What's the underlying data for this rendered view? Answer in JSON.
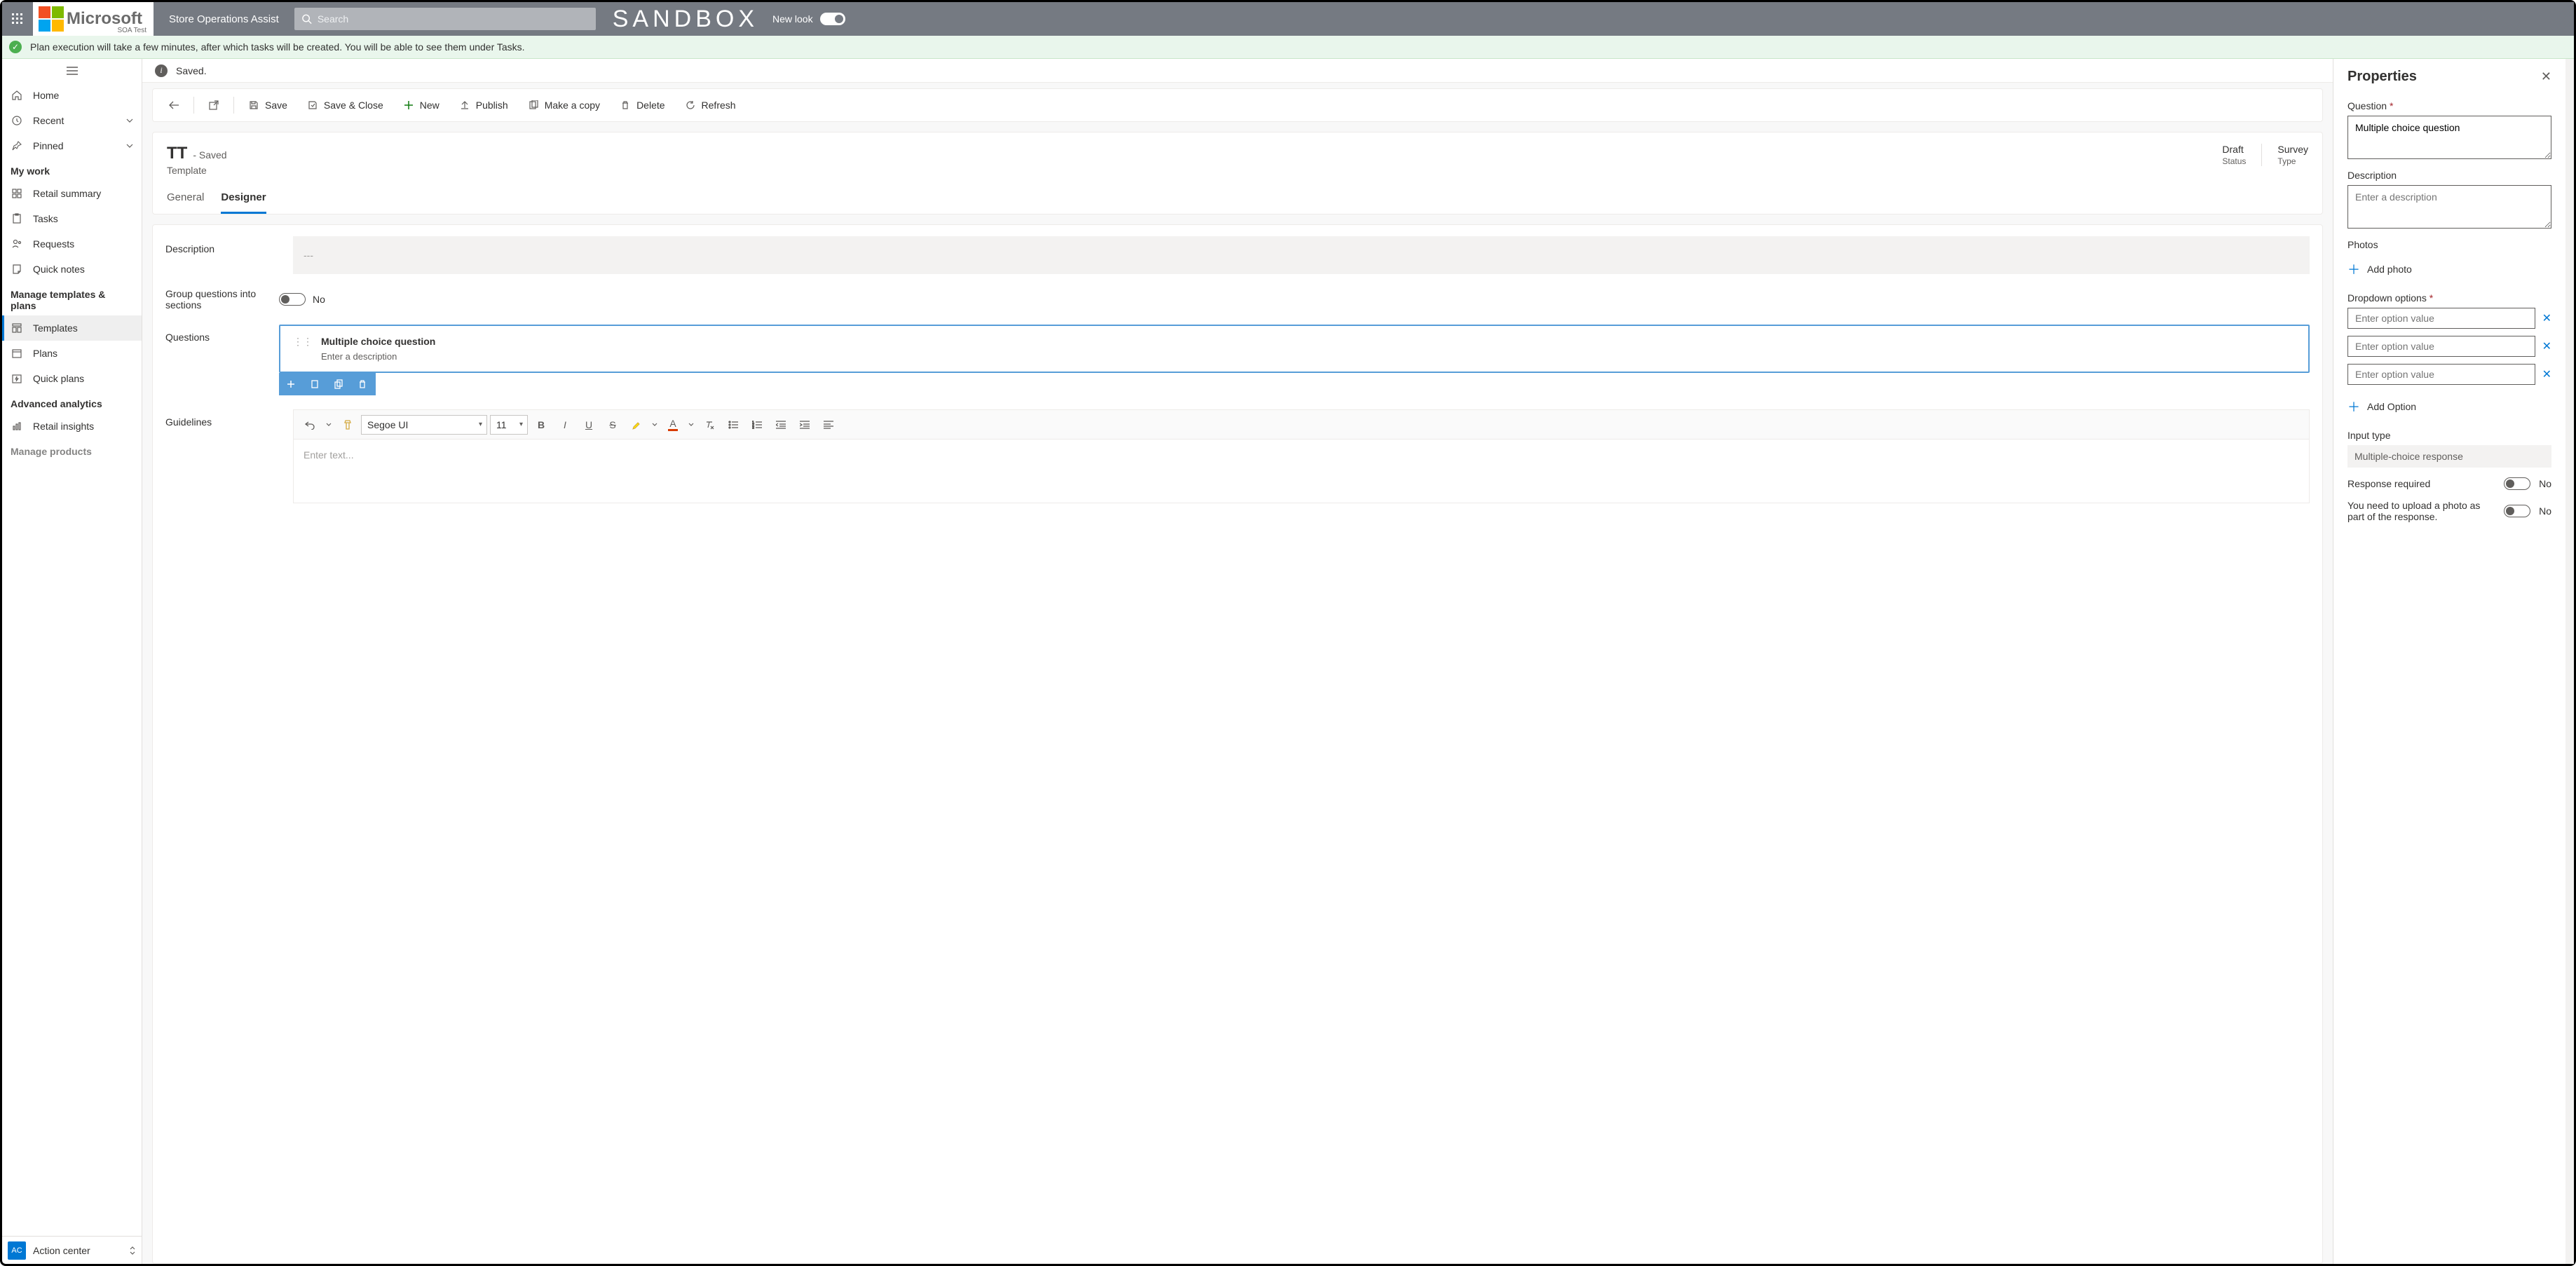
{
  "topnav": {
    "app_title": "Store Operations Assist",
    "search_placeholder": "Search",
    "sandbox": "SANDBOX",
    "logo_text": "Microsoft",
    "logo_sub": "SOA Test",
    "newlook": "New look"
  },
  "notification": "Plan execution will take a few minutes, after which tasks will be created. You will be able to see them under Tasks.",
  "saved_bar": "Saved.",
  "sidebar": {
    "items_top": [
      {
        "label": "Home"
      },
      {
        "label": "Recent",
        "caret": true
      },
      {
        "label": "Pinned",
        "caret": true
      }
    ],
    "group_mywork": "My work",
    "mywork": [
      {
        "label": "Retail summary"
      },
      {
        "label": "Tasks"
      },
      {
        "label": "Requests"
      },
      {
        "label": "Quick notes"
      }
    ],
    "group_templates": "Manage templates & plans",
    "templates": [
      {
        "label": "Templates",
        "selected": true
      },
      {
        "label": "Plans"
      },
      {
        "label": "Quick plans"
      }
    ],
    "group_analytics": "Advanced analytics",
    "analytics": [
      {
        "label": "Retail insights"
      }
    ],
    "group_products": "Manage products",
    "action_center": "Action center",
    "ac_badge": "AC"
  },
  "commands": {
    "save": "Save",
    "save_close": "Save & Close",
    "new": "New",
    "publish": "Publish",
    "make_copy": "Make a copy",
    "delete": "Delete",
    "refresh": "Refresh"
  },
  "record": {
    "title": "TT",
    "saved_suffix": "- Saved",
    "subtitle": "Template",
    "status_label": "Status",
    "status_value": "Draft",
    "type_label": "Type",
    "type_value": "Survey"
  },
  "tabs": {
    "general": "General",
    "designer": "Designer"
  },
  "form": {
    "description_label": "Description",
    "description_placeholder": "---",
    "group_label": "Group questions into sections",
    "group_value": "No",
    "questions_label": "Questions",
    "question_title": "Multiple choice question",
    "question_desc": "Enter a description",
    "guidelines_label": "Guidelines",
    "rte_font": "Segoe UI",
    "rte_size": "11",
    "rte_placeholder": "Enter text..."
  },
  "props": {
    "title": "Properties",
    "question_label": "Question",
    "question_value": "Multiple choice question",
    "description_label": "Description",
    "description_placeholder": "Enter a description",
    "photos_label": "Photos",
    "add_photo": "Add photo",
    "dropdown_label": "Dropdown options",
    "option_placeholder": "Enter option value",
    "add_option": "Add Option",
    "input_type_label": "Input type",
    "input_type_value": "Multiple-choice response",
    "response_required_label": "Response required",
    "response_required_value": "No",
    "upload_photo_label": "You need to upload a photo as part of the response.",
    "upload_photo_value": "No"
  }
}
